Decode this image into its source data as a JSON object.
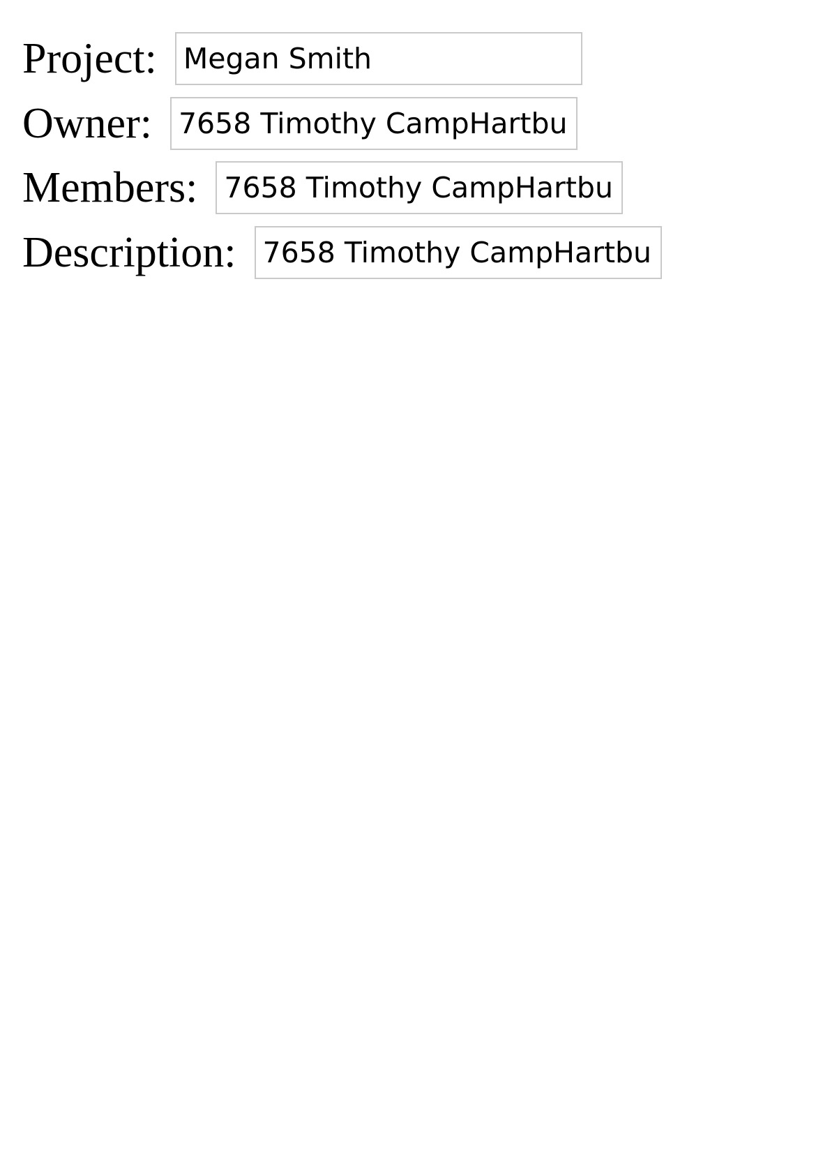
{
  "form": {
    "fields": [
      {
        "label": "Project:",
        "value": "Megan Smith"
      },
      {
        "label": "Owner:",
        "value": "7658 Timothy CampHartbu"
      },
      {
        "label": "Members:",
        "value": "7658 Timothy CampHartbu"
      },
      {
        "label": "Description:",
        "value": "7658 Timothy CampHartbu"
      }
    ]
  },
  "colors": {
    "background": "#ffffff",
    "input_border": "#c9c9c9",
    "text": "#000000"
  }
}
